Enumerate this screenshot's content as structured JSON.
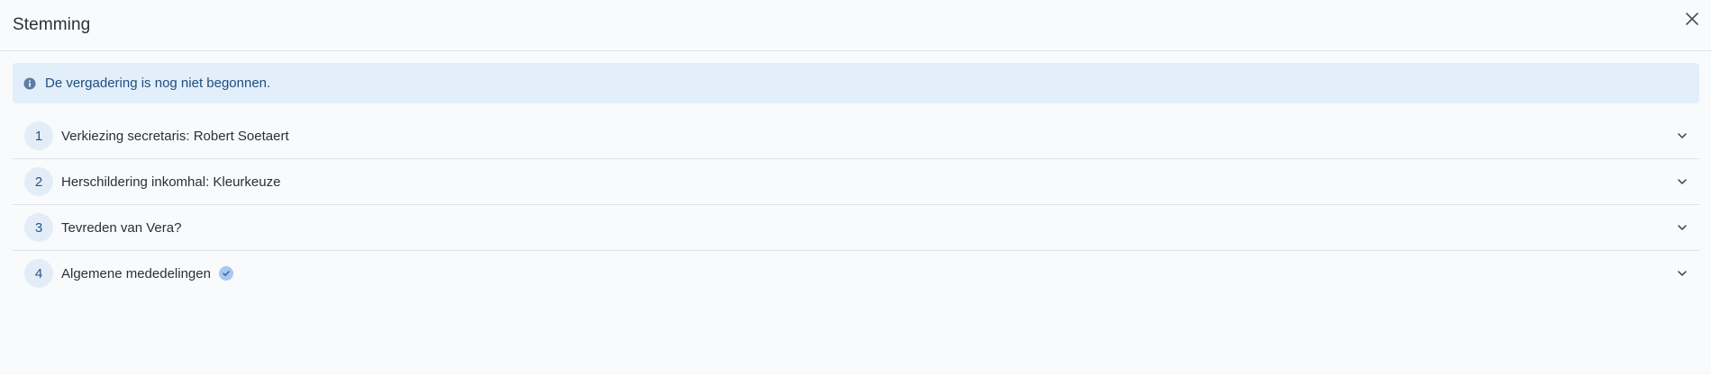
{
  "header": {
    "title": "Stemming"
  },
  "alert": {
    "text": "De vergadering is nog niet begonnen."
  },
  "items": [
    {
      "number": "1",
      "label": "Verkiezing secretaris: Robert Soetaert",
      "completed": false
    },
    {
      "number": "2",
      "label": "Herschildering inkomhal: Kleurkeuze",
      "completed": false
    },
    {
      "number": "3",
      "label": "Tevreden van Vera?",
      "completed": false
    },
    {
      "number": "4",
      "label": "Algemene mededelingen",
      "completed": true
    }
  ],
  "colors": {
    "alert_bg": "#e2effb",
    "alert_text": "#1d4f7f",
    "badge_bg": "#e3edf8",
    "check_bg": "#a9c8f0"
  },
  "icons": {
    "close": "close-icon",
    "info": "info-icon",
    "chevron": "chevron-down-icon",
    "check": "check-circle-icon"
  }
}
